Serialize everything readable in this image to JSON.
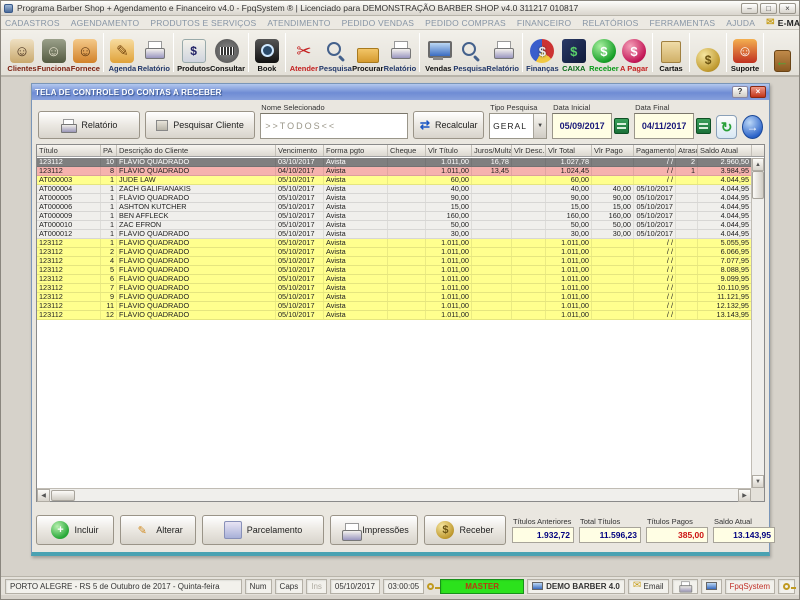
{
  "window": {
    "title": "Programa Barber Shop + Agendamento e Financeiro v4.0 - FpqSystem ® | Licenciado para  DEMONSTRAÇÃO BARBER SHOP v4.0 311217 010817",
    "minimize": "–",
    "maximize": "□",
    "close": "×"
  },
  "menu": {
    "items": [
      {
        "label": "CADASTROS"
      },
      {
        "label": "AGENDAMENTO"
      },
      {
        "label": "PRODUTOS E SERVIÇOS"
      },
      {
        "label": "ATENDIMENTO"
      },
      {
        "label": "PEDIDO VENDAS"
      },
      {
        "label": "PEDIDO COMPRAS"
      },
      {
        "label": "FINANCEIRO"
      },
      {
        "label": "RELATÓRIOS"
      },
      {
        "label": "FERRAMENTAS"
      },
      {
        "label": "AJUDA"
      },
      {
        "label": "E-MAIL",
        "email": true,
        "icon": "email-icon"
      }
    ]
  },
  "toolbar": {
    "groups": [
      {
        "items": [
          {
            "name": "clientes",
            "label": "Clientes",
            "label_color": "#7b1f10",
            "icon": "clients-icon",
            "glyph": "☺"
          },
          {
            "name": "funcionarios",
            "label": "Funciona",
            "label_color": "#7b1f10",
            "icon": "staff-icon",
            "glyph": "☺"
          },
          {
            "name": "fornecedores",
            "label": "Fornece",
            "label_color": "#7b1f10",
            "icon": "supplier-icon",
            "glyph": "☺"
          }
        ]
      },
      {
        "items": [
          {
            "name": "agenda",
            "label": "Agenda",
            "label_color": "#22386a",
            "icon": "agenda-icon",
            "glyph": "✎"
          },
          {
            "name": "agenda-relatorio",
            "label": "Relatório",
            "label_color": "#22386a",
            "icon": "printer-icon",
            "glyph": ""
          }
        ]
      },
      {
        "items": [
          {
            "name": "produtos",
            "label": "Produtos",
            "label_color": "#111111",
            "icon": "products-icon",
            "glyph": "$"
          },
          {
            "name": "consultar",
            "label": "Consultar",
            "label_color": "#111111",
            "icon": "barcode-icon",
            "glyph": ""
          }
        ]
      },
      {
        "items": [
          {
            "name": "book",
            "label": "Book",
            "label_color": "#111111",
            "icon": "camera-icon",
            "glyph": ""
          }
        ]
      },
      {
        "items": [
          {
            "name": "atender",
            "label": "Atender",
            "label_color": "#c42020",
            "icon": "scissors-icon",
            "glyph": "✂"
          },
          {
            "name": "atend-pesquisa",
            "label": "Pesquisa",
            "label_color": "#22386a",
            "icon": "search-icon",
            "glyph": ""
          },
          {
            "name": "procurar",
            "label": "Procurar",
            "label_color": "#111111",
            "icon": "folder-icon",
            "glyph": ""
          },
          {
            "name": "atend-relatorio",
            "label": "Relatório",
            "label_color": "#22386a",
            "icon": "printer-icon",
            "glyph": ""
          }
        ]
      },
      {
        "items": [
          {
            "name": "vendas",
            "label": "Vendas",
            "label_color": "#111111",
            "icon": "monitor-icon",
            "glyph": ""
          },
          {
            "name": "vendas-pesquisa",
            "label": "Pesquisa",
            "label_color": "#22386a",
            "icon": "search-icon",
            "glyph": ""
          },
          {
            "name": "vendas-relatorio",
            "label": "Relatório",
            "label_color": "#22386a",
            "icon": "printer-icon",
            "glyph": ""
          }
        ]
      },
      {
        "items": [
          {
            "name": "financas",
            "label": "Finanças",
            "label_color": "#22386a",
            "icon": "finance-pie-icon",
            "glyph": "$"
          },
          {
            "name": "caixa",
            "label": "CAIXA",
            "label_color": "#0a6a1a",
            "icon": "cashbook-icon",
            "glyph": "$"
          },
          {
            "name": "receber",
            "label": "Receber",
            "label_color": "#0a9a1a",
            "icon": "receive-coin-icon",
            "glyph": "$"
          },
          {
            "name": "a-pagar",
            "label": "A Pagar",
            "label_color": "#c42020",
            "icon": "pay-coin-icon",
            "glyph": "$"
          }
        ]
      },
      {
        "items": [
          {
            "name": "cartas",
            "label": "Cartas",
            "label_color": "#111111",
            "icon": "letters-icon",
            "glyph": ""
          }
        ]
      },
      {
        "items": [
          {
            "name": "moeda",
            "label": "",
            "icon": "coin-icon",
            "glyph": "$"
          }
        ]
      },
      {
        "items": [
          {
            "name": "suporte",
            "label": "Suporte",
            "label_color": "#111111",
            "icon": "support-icon",
            "glyph": "☺"
          }
        ]
      },
      {
        "items": [
          {
            "name": "sair",
            "label": "",
            "icon": "exit-door-icon",
            "glyph": "←"
          }
        ]
      }
    ]
  },
  "dialog": {
    "title": "TELA DE CONTROLE DO CONTAS A RECEBER",
    "help_button": "?",
    "close_button": "×",
    "controls": {
      "report_button": "Relatório",
      "search_client_button": "Pesquisar Cliente",
      "selected_name_label": "Nome Selecionado",
      "selected_name_value": ">>TODOS<<",
      "recalc_button": "Recalcular",
      "recalc_glyph": "⇄",
      "search_type_label": "Tipo Pesquisa",
      "search_type_value": "GERAL",
      "combo_arrow": "▼",
      "date_start_label": "Data Inicial",
      "date_start_value": "05/09/2017",
      "date_end_label": "Data Final",
      "date_end_value": "04/11/2017",
      "refresh_glyph": "↻",
      "go_glyph": "→"
    },
    "table": {
      "columns": [
        "Título",
        "PA",
        "Descrição do Cliente",
        "Vencimento",
        "Forma pgto",
        "Cheque",
        "Vlr Título",
        "Juros/Multa",
        "Vlr Desc.",
        "Vlr Total",
        "Vlr Pago",
        "Pagamento",
        "Atraso",
        "Saldo Atual"
      ],
      "rows": [
        {
          "color": "selected",
          "cells": [
            "123112",
            "10",
            "FLÁVIO QUADRADO",
            "03/10/2017",
            "Avista",
            "",
            "1.011,00",
            "16,78",
            "",
            "1.027,78",
            "",
            "/ /",
            "2",
            "2.960,50"
          ]
        },
        {
          "color": "pink",
          "cells": [
            "123112",
            "8",
            "FLÁVIO QUADRADO",
            "04/10/2017",
            "Avista",
            "",
            "1.011,00",
            "13,45",
            "",
            "1.024,45",
            "",
            "/ /",
            "1",
            "3.984,95"
          ]
        },
        {
          "color": "yellow",
          "cells": [
            "AT000003",
            "1",
            "JUDE LAW",
            "05/10/2017",
            "Avista",
            "",
            "60,00",
            "",
            "",
            "60,00",
            "",
            "/ /",
            "",
            "4.044,95"
          ]
        },
        {
          "color": "plain",
          "cells": [
            "AT000004",
            "1",
            "ZACH GALIFIANAKIS",
            "05/10/2017",
            "Avista",
            "",
            "40,00",
            "",
            "",
            "40,00",
            "40,00",
            "05/10/2017",
            "",
            "4.044,95"
          ]
        },
        {
          "color": "plain",
          "cells": [
            "AT000005",
            "1",
            "FLÁVIO QUADRADO",
            "05/10/2017",
            "Avista",
            "",
            "90,00",
            "",
            "",
            "90,00",
            "90,00",
            "05/10/2017",
            "",
            "4.044,95"
          ]
        },
        {
          "color": "plain",
          "cells": [
            "AT000006",
            "1",
            "ASHTON KUTCHER",
            "05/10/2017",
            "Avista",
            "",
            "15,00",
            "",
            "",
            "15,00",
            "15,00",
            "05/10/2017",
            "",
            "4.044,95"
          ]
        },
        {
          "color": "plain",
          "cells": [
            "AT000009",
            "1",
            "BEN AFFLECK",
            "05/10/2017",
            "Avista",
            "",
            "160,00",
            "",
            "",
            "160,00",
            "160,00",
            "05/10/2017",
            "",
            "4.044,95"
          ]
        },
        {
          "color": "plain",
          "cells": [
            "AT000010",
            "1",
            "ZAC EFRON",
            "05/10/2017",
            "Avista",
            "",
            "50,00",
            "",
            "",
            "50,00",
            "50,00",
            "05/10/2017",
            "",
            "4.044,95"
          ]
        },
        {
          "color": "plain",
          "cells": [
            "AT000012",
            "1",
            "FLÁVIO QUADRADO",
            "05/10/2017",
            "Avista",
            "",
            "30,00",
            "",
            "",
            "30,00",
            "30,00",
            "05/10/2017",
            "",
            "4.044,95"
          ]
        },
        {
          "color": "yellow",
          "cells": [
            "123112",
            "1",
            "FLÁVIO QUADRADO",
            "05/10/2017",
            "Avista",
            "",
            "1.011,00",
            "",
            "",
            "1.011,00",
            "",
            "/ /",
            "",
            "5.055,95"
          ]
        },
        {
          "color": "yellow",
          "cells": [
            "123112",
            "2",
            "FLÁVIO QUADRADO",
            "05/10/2017",
            "Avista",
            "",
            "1.011,00",
            "",
            "",
            "1.011,00",
            "",
            "/ /",
            "",
            "6.066,95"
          ]
        },
        {
          "color": "yellow",
          "cells": [
            "123112",
            "4",
            "FLÁVIO QUADRADO",
            "05/10/2017",
            "Avista",
            "",
            "1.011,00",
            "",
            "",
            "1.011,00",
            "",
            "/ /",
            "",
            "7.077,95"
          ]
        },
        {
          "color": "yellow",
          "cells": [
            "123112",
            "5",
            "FLÁVIO QUADRADO",
            "05/10/2017",
            "Avista",
            "",
            "1.011,00",
            "",
            "",
            "1.011,00",
            "",
            "/ /",
            "",
            "8.088,95"
          ]
        },
        {
          "color": "yellow",
          "cells": [
            "123112",
            "6",
            "FLÁVIO QUADRADO",
            "05/10/2017",
            "Avista",
            "",
            "1.011,00",
            "",
            "",
            "1.011,00",
            "",
            "/ /",
            "",
            "9.099,95"
          ]
        },
        {
          "color": "yellow",
          "cells": [
            "123112",
            "7",
            "FLÁVIO QUADRADO",
            "05/10/2017",
            "Avista",
            "",
            "1.011,00",
            "",
            "",
            "1.011,00",
            "",
            "/ /",
            "",
            "10.110,95"
          ]
        },
        {
          "color": "yellow",
          "cells": [
            "123112",
            "9",
            "FLÁVIO QUADRADO",
            "05/10/2017",
            "Avista",
            "",
            "1.011,00",
            "",
            "",
            "1.011,00",
            "",
            "/ /",
            "",
            "11.121,95"
          ]
        },
        {
          "color": "yellow",
          "cells": [
            "123112",
            "11",
            "FLÁVIO QUADRADO",
            "05/10/2017",
            "Avista",
            "",
            "1.011,00",
            "",
            "",
            "1.011,00",
            "",
            "/ /",
            "",
            "12.132,95"
          ]
        },
        {
          "color": "yellow",
          "cells": [
            "123112",
            "12",
            "FLÁVIO QUADRADO",
            "05/10/2017",
            "Avista",
            "",
            "1.011,00",
            "",
            "",
            "1.011,00",
            "",
            "/ /",
            "",
            "13.143,95"
          ]
        }
      ]
    },
    "footer": {
      "buttons": [
        {
          "name": "incluir",
          "label": "Incluir",
          "icon": "add-icon",
          "glyph": "+"
        },
        {
          "name": "alterar",
          "label": "Alterar",
          "icon": "edit-icon",
          "glyph": "✎"
        },
        {
          "name": "parcelamento",
          "label": "Parcelamento",
          "icon": "installments-icon",
          "glyph": ""
        },
        {
          "name": "impressoes",
          "label": "Impressões",
          "icon": "printer-icon",
          "glyph": ""
        },
        {
          "name": "receber",
          "label": "Receber",
          "icon": "coin-icon",
          "glyph": "$"
        }
      ],
      "totals": [
        {
          "label": "Títulos Anteriores",
          "value": "1.932,72",
          "color": "#00007f"
        },
        {
          "label": "Total Títulos",
          "value": "11.596,23",
          "color": "#00007f"
        },
        {
          "label": "Títulos Pagos",
          "value": "385,00",
          "color": "#cc1111"
        },
        {
          "label": "Saldo Atual",
          "value": "13.143,95",
          "color": "#00007f"
        }
      ]
    }
  },
  "statusbar": {
    "location": "PORTO ALEGRE - RS  5 de Outubro de 2017 - Quinta-feira",
    "num": "Num",
    "caps": "Caps",
    "ins": "Ins",
    "date": "05/10/2017",
    "time": "03:00:05",
    "master": "MASTER",
    "station": "DEMO BARBER 4.0",
    "email": "Email",
    "brand": "FpqSystem"
  }
}
